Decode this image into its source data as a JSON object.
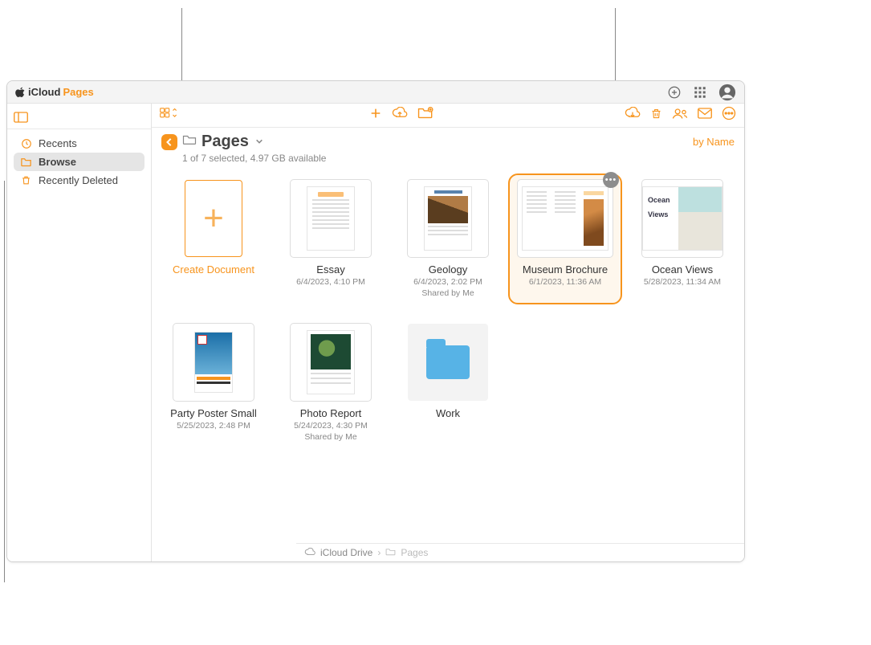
{
  "titlebar": {
    "brand_prefix": "iCloud",
    "app_name": "Pages"
  },
  "sidebar": {
    "items": [
      {
        "label": "Recents",
        "icon": "clock-icon"
      },
      {
        "label": "Browse",
        "icon": "folder-icon"
      },
      {
        "label": "Recently Deleted",
        "icon": "trash-icon"
      }
    ]
  },
  "path": {
    "folder_name": "Pages",
    "selection_info": "1 of 7 selected, 4.97 GB available"
  },
  "sort": {
    "label": "by Name"
  },
  "create_tile": {
    "label": "Create Document"
  },
  "documents": [
    {
      "name": "Essay",
      "date": "6/4/2023, 4:10 PM",
      "shared": ""
    },
    {
      "name": "Geology",
      "date": "6/4/2023, 2:02 PM",
      "shared": "Shared by Me"
    },
    {
      "name": "Museum Brochure",
      "date": "6/1/2023, 11:36 AM",
      "shared": ""
    },
    {
      "name": "Ocean Views",
      "date": "5/28/2023, 11:34 AM",
      "shared": ""
    },
    {
      "name": "Party Poster Small",
      "date": "5/25/2023, 2:48 PM",
      "shared": ""
    },
    {
      "name": "Photo Report",
      "date": "5/24/2023, 4:30 PM",
      "shared": "Shared by Me"
    }
  ],
  "folders": [
    {
      "name": "Work"
    }
  ],
  "breadcrumb": {
    "root": "iCloud Drive",
    "current": "Pages"
  },
  "more_button": {
    "glyph": "•••"
  },
  "ocean_card": {
    "title": "Ocean\nViews"
  }
}
